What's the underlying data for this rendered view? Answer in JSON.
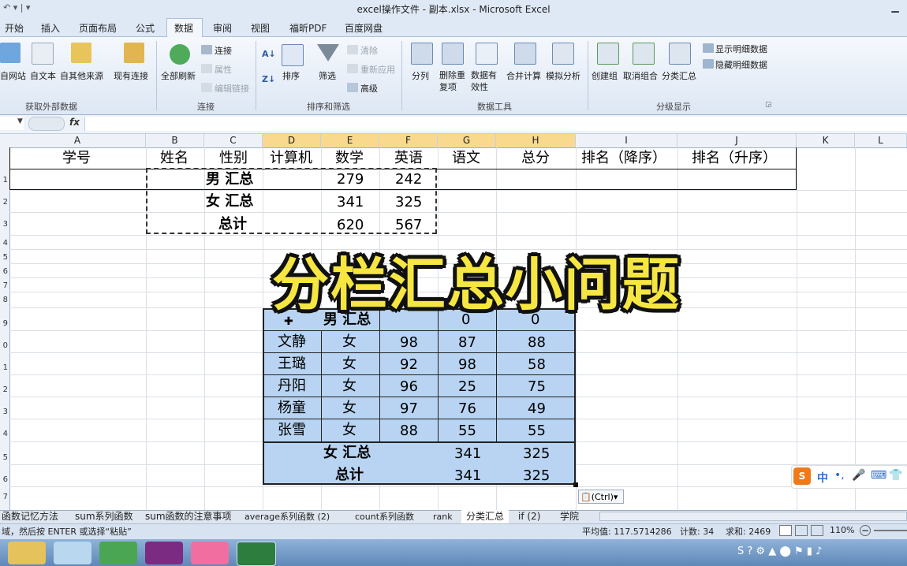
{
  "window": {
    "title": "excel操作文件 - 副本.xlsx - Microsoft Excel"
  },
  "tabs": [
    "开始",
    "插入",
    "页面布局",
    "公式",
    "数据",
    "审阅",
    "视图",
    "福昕PDF",
    "百度网盘"
  ],
  "ribbon": {
    "external": {
      "items": [
        "自网站",
        "自文本",
        "自其他来源",
        "现有连接"
      ],
      "group": "获取外部数据"
    },
    "connections": {
      "refresh": "全部刷新",
      "small": [
        "连接",
        "属性",
        "编辑链接"
      ],
      "group": "连接"
    },
    "sort": {
      "sort": "排序",
      "filter": "筛选",
      "small": [
        "清除",
        "重新应用",
        "高级"
      ],
      "group": "排序和筛选"
    },
    "tools": {
      "items": [
        "分列",
        "删除重复项",
        "数据有效性",
        "合并计算",
        "模拟分析"
      ],
      "group": "数据工具"
    },
    "outline": {
      "items": [
        "创建组",
        "取消组合",
        "分类汇总"
      ],
      "small": [
        "显示明细数据",
        "隐藏明细数据"
      ],
      "group": "分级显示"
    }
  },
  "formula": {
    "fx": "fx",
    "value": ""
  },
  "columns": [
    "A",
    "B",
    "C",
    "D",
    "E",
    "F",
    "G",
    "H",
    "I",
    "J",
    "K",
    "L"
  ],
  "header_row": [
    "学号",
    "姓名",
    "性别",
    "计算机",
    "数学",
    "英语",
    "语文",
    "总分",
    "排名（降序）",
    "排名（升序）"
  ],
  "summary": [
    {
      "label": "男 汇总",
      "math": "279",
      "english": "242"
    },
    {
      "label": "女 汇总",
      "math": "341",
      "english": "325"
    },
    {
      "label": "总计",
      "math": "620",
      "english": "567"
    }
  ],
  "row_numbers": [
    "1",
    "2",
    "3",
    "4",
    "5",
    "6",
    "7",
    "8",
    "9",
    "0",
    "1",
    "2",
    "3",
    "4",
    "5",
    "6",
    "7"
  ],
  "overlay_title": "分栏汇总小问题",
  "detail": {
    "top": {
      "label": "男 汇总",
      "v1": "0",
      "v2": "0"
    },
    "rows": [
      {
        "name": "文静",
        "gender": "女",
        "a": "98",
        "b": "87",
        "c": "88"
      },
      {
        "name": "王璐",
        "gender": "女",
        "a": "92",
        "b": "98",
        "c": "58"
      },
      {
        "name": "丹阳",
        "gender": "女",
        "a": "96",
        "b": "25",
        "c": "75"
      },
      {
        "name": "杨童",
        "gender": "女",
        "a": "97",
        "b": "76",
        "c": "49"
      },
      {
        "name": "张雪",
        "gender": "女",
        "a": "88",
        "b": "55",
        "c": "55"
      }
    ],
    "sub": {
      "label": "女 汇总",
      "v1": "341",
      "v2": "325"
    },
    "total": {
      "label": "总计",
      "v1": "341",
      "v2": "325"
    }
  },
  "paste_options": "(Ctrl)▾",
  "sheets": [
    "函数记忆方法",
    "sum系列函数",
    "sum函数的注意事项",
    "average系列函数 (2)",
    "count系列函数",
    "rank",
    "分类汇总",
    "if (2)",
    "学院"
  ],
  "status": {
    "message": "域，然后按 ENTER 或选择“粘贴”",
    "average": "平均值: 117.5714286",
    "count": "计数: 34",
    "sum": "求和: 2469",
    "zoom": "110%"
  },
  "ime": {
    "lang": "中"
  }
}
